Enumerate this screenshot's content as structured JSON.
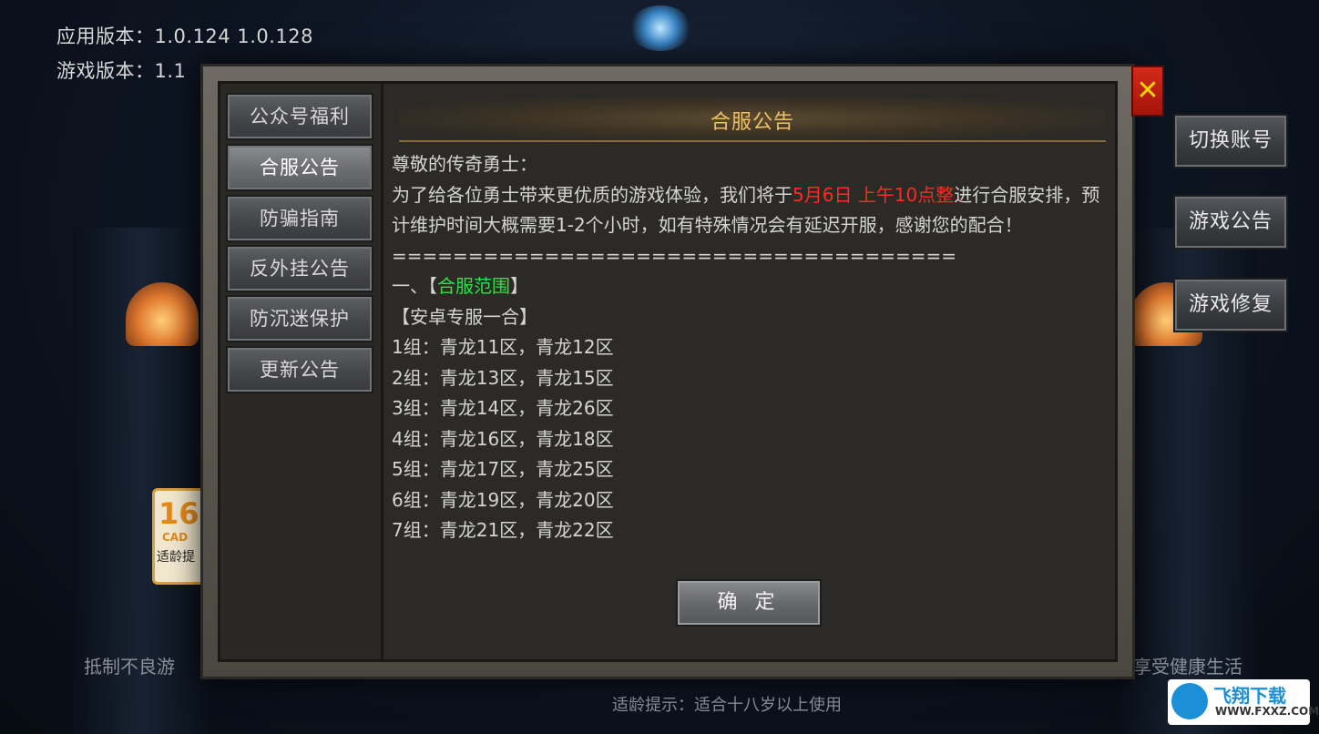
{
  "header": {
    "app_version_label": "应用版本：1.0.124  1.0.128",
    "game_version_label": "游戏版本：1.1"
  },
  "side_buttons": [
    "切换账号",
    "游戏公告",
    "游戏修复"
  ],
  "age_badge": {
    "number": "16",
    "code": "CAD",
    "label": "适龄提"
  },
  "footer": {
    "left_notice": "抵制不良游",
    "right_notice": "享受健康生活",
    "age_tip": "适龄提示：适合十八岁以上使用"
  },
  "dialog": {
    "close_label": "✕",
    "nav_items": [
      "公众号福利",
      "合服公告",
      "防骗指南",
      "反外挂公告",
      "防沉迷保护",
      "更新公告"
    ],
    "active_nav": 1,
    "title": "合服公告",
    "greeting": "尊敬的传奇勇士：",
    "intro_before": "为了给各位勇士带来更优质的游戏体验，我们将于",
    "intro_highlight": "5月6日 上午10点整",
    "intro_after": "进行合服安排，预计维护时间大概需要1-2个小时，如有特殊情况会有延迟开服，感谢您的配合！",
    "divider": "=====================================",
    "section_prefix": "一、【",
    "section_title": "合服范围",
    "section_suffix": "】",
    "subsection": "【安卓专服一合】",
    "groups": [
      "1组：青龙11区，青龙12区",
      "2组：青龙13区，青龙15区",
      "3组：青龙14区，青龙26区",
      "4组：青龙16区，青龙18区",
      "5组：青龙17区，青龙25区",
      "6组：青龙19区，青龙20区",
      "7组：青龙21区，青龙22区"
    ],
    "confirm_label": "确 定"
  },
  "watermark": {
    "name": "飞翔下载",
    "url": "WWW.FXXZ.COM"
  },
  "colors": {
    "highlight_red": "#ff2a1e",
    "highlight_green": "#2ee04a",
    "title_gold": "#f0c069"
  }
}
